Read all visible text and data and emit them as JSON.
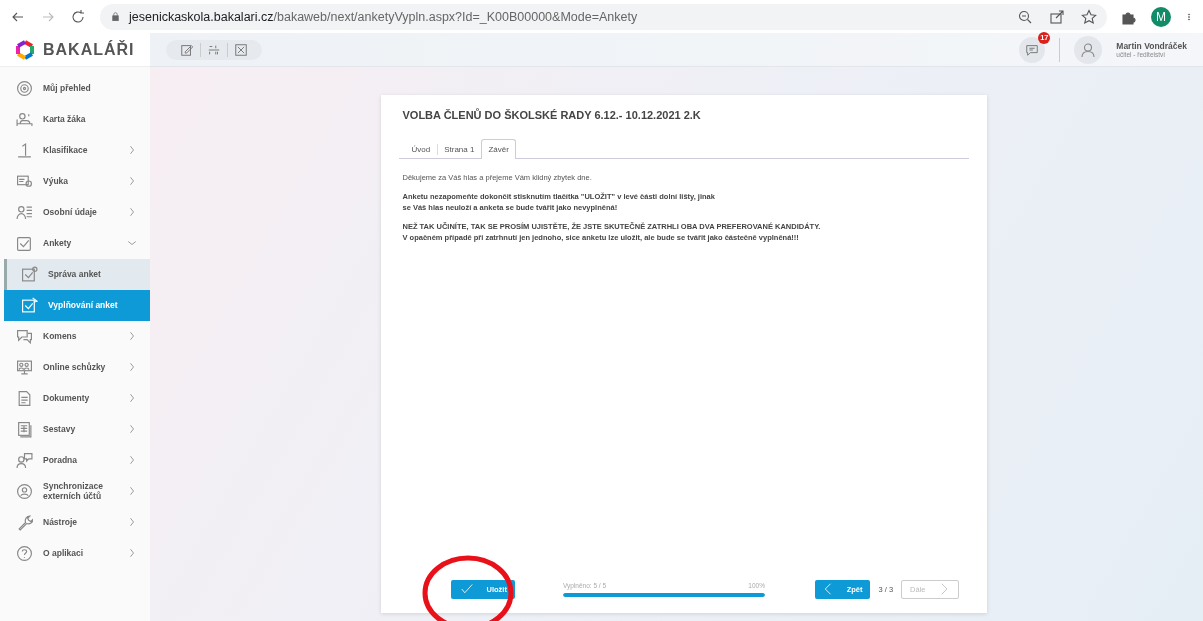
{
  "browser": {
    "url_host": "jesenickaskola.bakalari.cz",
    "url_path": "/bakaweb/next/anketyVypln.aspx?Id=_K00B00000&Mode=Ankety",
    "forward_disabled": true,
    "profile_initial": "M"
  },
  "app": {
    "logo_text": "BAKALÁŘI",
    "notification_count": "17",
    "user_name": "Martin Vondráček",
    "user_role": "učitel - ředitelství"
  },
  "sidebar": {
    "items": [
      {
        "label": "Můj přehled",
        "expandable": false,
        "expanded": false
      },
      {
        "label": "Karta žáka",
        "expandable": false,
        "expanded": false
      },
      {
        "label": "Klasifikace",
        "expandable": true,
        "expanded": false
      },
      {
        "label": "Výuka",
        "expandable": true,
        "expanded": false
      },
      {
        "label": "Osobní údaje",
        "expandable": true,
        "expanded": false
      },
      {
        "label": "Ankety",
        "expandable": true,
        "expanded": true,
        "children": [
          {
            "label": "Správa anket",
            "selected": false,
            "hovered": true
          },
          {
            "label": "Vyplňování anket",
            "selected": true,
            "hovered": false
          }
        ]
      },
      {
        "label": "Komens",
        "expandable": true,
        "expanded": false
      },
      {
        "label": "Online schůzky",
        "expandable": true,
        "expanded": false
      },
      {
        "label": "Dokumenty",
        "expandable": true,
        "expanded": false
      },
      {
        "label": "Sestavy",
        "expandable": true,
        "expanded": false
      },
      {
        "label": "Poradna",
        "expandable": true,
        "expanded": false
      },
      {
        "label": "Synchronizace externích účtů",
        "expandable": true,
        "expanded": false
      },
      {
        "label": "Nástroje",
        "expandable": true,
        "expanded": false
      },
      {
        "label": "O aplikaci",
        "expandable": true,
        "expanded": false
      }
    ]
  },
  "survey": {
    "title": "VOLBA ČLENŮ DO ŠKOLSKÉ RADY 6.12.- 10.12.2021 2.K",
    "tabs": [
      {
        "label": "Úvod",
        "selected": false
      },
      {
        "label": "Strana 1",
        "selected": false
      },
      {
        "label": "Závěr",
        "selected": true
      }
    ],
    "paragraphs": [
      {
        "bold": false,
        "lines": [
          "Děkujeme za Váš hlas a přejeme Vám klidný zbytek dne."
        ]
      },
      {
        "bold": true,
        "lines": [
          "Anketu nezapomeňte dokončit stisknutím tlačítka \"ULOŽIT\" v levé části dolní lišty, jinak",
          "se Váš hlas neuloží a anketa se bude tvářit jako nevyplněná!"
        ]
      },
      {
        "bold": true,
        "lines": [
          "NEŽ TAK UČINÍTE, TAK SE PROSÍM UJISTĚTE, ŽE JSTE SKUTEČNĚ ZATRHLI OBA DVA PREFEROVANÉ KANDIDÁTY.",
          "V opačném případě při zatrhnutí jen jednoho, sice anketu lze uložit, ale bude se tvářit jako částečně vyplněná!!!"
        ]
      }
    ],
    "footer": {
      "save_label": "Uložit",
      "progress_label": "Vyplněno: 5 / 5",
      "progress_percent": "100%",
      "level": 1.0,
      "back_label": "Zpět",
      "page_counter": "3 / 3",
      "next_label": "Dále",
      "next_disabled": true
    }
  },
  "annotations": [
    {
      "kind": "circle"
    }
  ]
}
